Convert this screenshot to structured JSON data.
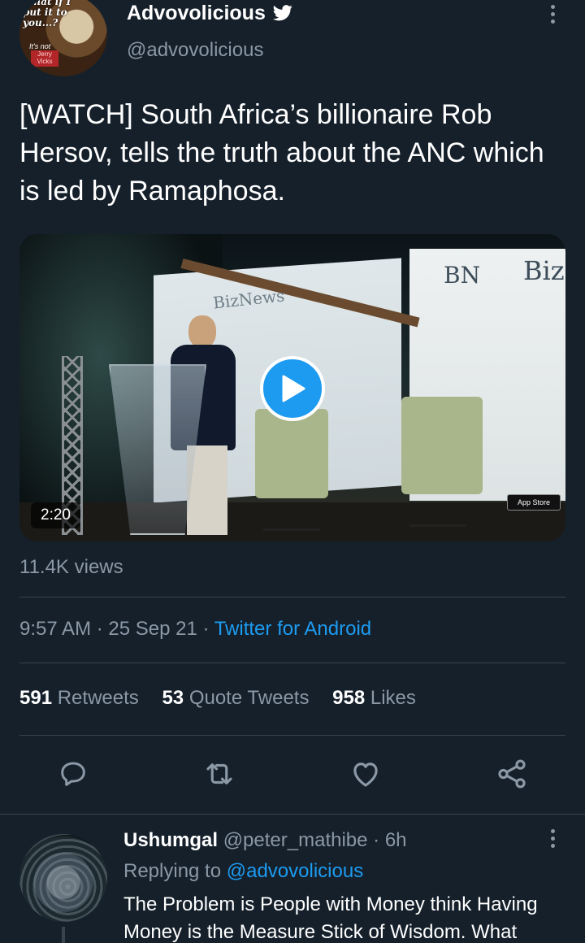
{
  "tweet": {
    "author": {
      "display_name": "Advovolicious",
      "handle": "@advovolicious",
      "avatar_caption_1": "What if I put it to you...?",
      "avatar_caption_2": "It's not",
      "avatar_caption_3": "Jerry Vicks",
      "verified_icon": "twitter-bird-icon"
    },
    "text": "[WATCH] South Africa’s billionaire Rob Hersov, tells the truth about the ANC which is led by Ramaphosa.",
    "video": {
      "duration": "2:20",
      "views": "11.4K views",
      "scene_text": {
        "bn": "BN",
        "biz": "Biz",
        "biznews": "BizNews",
        "store_badge": "App Store"
      }
    },
    "timestamp": "9:57 AM · 25 Sep 21 · ",
    "source": "Twitter for Android",
    "stats": {
      "retweets_count": "591",
      "retweets_label": "Retweets",
      "quotes_count": "53",
      "quotes_label": "Quote Tweets",
      "likes_count": "958",
      "likes_label": "Likes"
    },
    "actions": [
      "reply-icon",
      "retweet-icon",
      "like-icon",
      "share-icon"
    ]
  },
  "reply": {
    "display_name": "Ushumgal",
    "handle": "@peter_mathibe",
    "time": " · 6h",
    "replying_prefix": "Replying to ",
    "replying_to": "@advovolicious",
    "text": "The Problem is People with Money think Having Money is the Measure Stick of Wisdom. What"
  },
  "colors": {
    "background": "#15202b",
    "muted": "#8b98a5",
    "accent": "#1d9bf0",
    "divider": "#38444d"
  }
}
